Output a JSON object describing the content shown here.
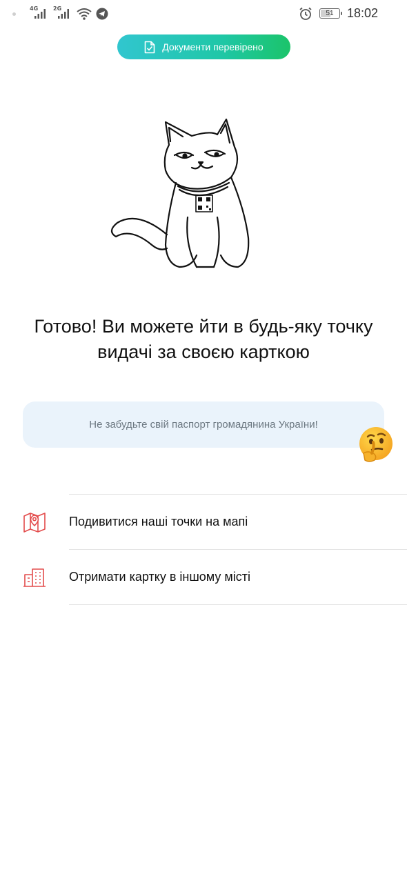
{
  "status_bar": {
    "network1": "4G",
    "network2": "2G",
    "battery": "51",
    "time": "18:02"
  },
  "verified": {
    "label": "Документи перевірено",
    "icon": "document-check-icon"
  },
  "headline": {
    "line1": "Готово! Ви можете йти в будь-яку точку",
    "line2": "видачі за своєю карткою"
  },
  "note": {
    "text": "Не забудьте свій паспорт громадянина України!",
    "emoji": "thinking-face"
  },
  "menu": [
    {
      "label": "Подивитися наші точки на мапі",
      "icon": "map-pin-icon"
    },
    {
      "label": "Отримати картку в іншому місті",
      "icon": "building-icon"
    }
  ],
  "colors": {
    "accent_red": "#e34b4b",
    "pill_gradient_start": "#31c6cf",
    "pill_gradient_end": "#1bc46a",
    "note_bg": "#eaf3fb"
  }
}
